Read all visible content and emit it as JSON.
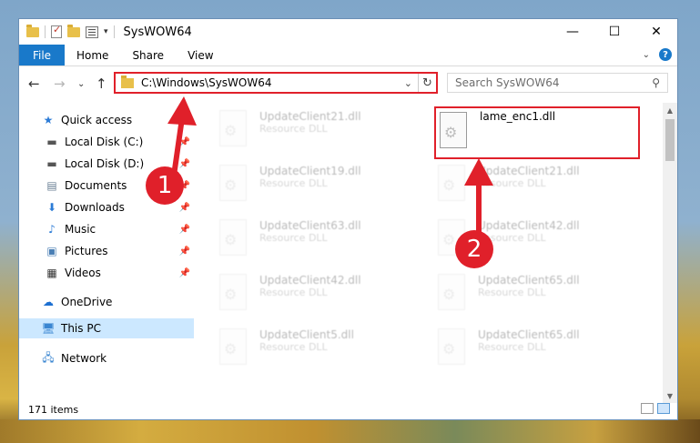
{
  "window": {
    "title": "SysWOW64",
    "controls": {
      "minimize": "—",
      "maximize": "☐",
      "close": "✕"
    }
  },
  "ribbon": {
    "tabs": [
      "File",
      "Home",
      "Share",
      "View"
    ],
    "help": "?"
  },
  "address": {
    "path": "C:\\Windows\\SysWOW64",
    "search_placeholder": "Search SysWOW64"
  },
  "nav": {
    "items": [
      {
        "label": "Quick access",
        "icon": "star-icon",
        "pinned": false
      },
      {
        "label": "Local Disk (C:)",
        "icon": "drive-icon",
        "pinned": true
      },
      {
        "label": "Local Disk (D:)",
        "icon": "drive-icon",
        "pinned": true
      },
      {
        "label": "Documents",
        "icon": "documents-icon",
        "pinned": true
      },
      {
        "label": "Downloads",
        "icon": "download-icon",
        "pinned": true
      },
      {
        "label": "Music",
        "icon": "music-icon",
        "pinned": true
      },
      {
        "label": "Pictures",
        "icon": "pictures-icon",
        "pinned": true
      },
      {
        "label": "Videos",
        "icon": "videos-icon",
        "pinned": true
      },
      {
        "label": "OneDrive",
        "icon": "cloud-icon",
        "pinned": false
      },
      {
        "label": "This PC",
        "icon": "computer-icon",
        "pinned": false,
        "selected": true
      },
      {
        "label": "Network",
        "icon": "network-icon",
        "pinned": false
      }
    ]
  },
  "files": {
    "col1": [
      {
        "name": "UpdateClient21.dll",
        "type": "Resource DLL"
      },
      {
        "name": "UpdateClient19.dll",
        "type": "Resource DLL"
      },
      {
        "name": "UpdateClient63.dll",
        "type": "Resource DLL"
      },
      {
        "name": "UpdateClient42.dll",
        "type": "Resource DLL"
      },
      {
        "name": "UpdateClient5.dll",
        "type": "Resource DLL"
      }
    ],
    "col2": [
      {
        "name": "lame_enc1.dll",
        "type": "",
        "highlighted": true
      },
      {
        "name": "UpdateClient21.dll",
        "type": "Resource DLL"
      },
      {
        "name": "UpdateClient42.dll",
        "type": "Resource DLL"
      },
      {
        "name": "UpdateClient65.dll",
        "type": "Resource DLL"
      },
      {
        "name": "UpdateClient65.dll",
        "type": "Resource DLL"
      }
    ]
  },
  "status": {
    "item_count": "171 items"
  },
  "annotations": {
    "marker1": "1",
    "marker2": "2",
    "accent_color": "#e0202a"
  }
}
